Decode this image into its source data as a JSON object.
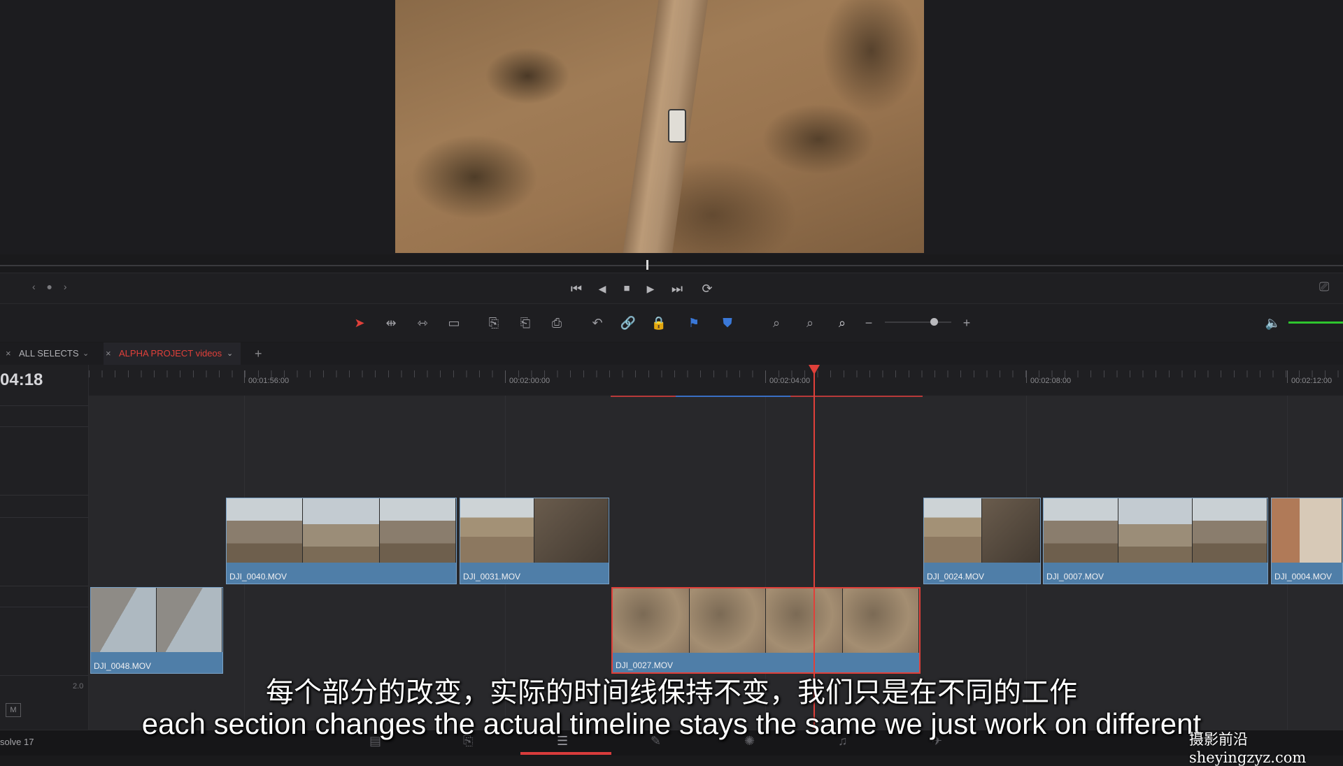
{
  "viewer": {
    "nav_dots": "‹ ● ›"
  },
  "transport": {
    "buttons": [
      {
        "name": "go-to-start",
        "glyph": "⏮"
      },
      {
        "name": "step-back",
        "glyph": "◀"
      },
      {
        "name": "stop",
        "glyph": "■"
      },
      {
        "name": "play",
        "glyph": "▶"
      },
      {
        "name": "go-to-end",
        "glyph": "⏭"
      },
      {
        "name": "loop",
        "glyph": "⟳"
      }
    ]
  },
  "toolbar": {
    "tools": [
      "➤",
      "⇹",
      "⇿",
      "▭",
      "⎘",
      "⎗",
      "⎙",
      "↶",
      "🔗",
      "🔒",
      "⚑",
      "⛊",
      "⌕",
      "⌕",
      "⌕"
    ],
    "zoom_minus": "−",
    "zoom_plus": "+",
    "volume_glyph": "🔈"
  },
  "tabs": [
    {
      "label": "ALL SELECTS",
      "active": false
    },
    {
      "label": "ALPHA PROJECT videos",
      "active": true
    }
  ],
  "tab_add": "+",
  "timeline": {
    "timecode": "04:18",
    "ruler_labels": [
      "00:01:56:00",
      "00:02:00:00",
      "00:02:04:00",
      "00:02:08:00",
      "00:02:12:00"
    ],
    "clips_v2": [
      "DJI_0040.MOV",
      "DJI_0031.MOV",
      "DJI_0024.MOV",
      "DJI_0007.MOV",
      "DJI_0004.MOV"
    ],
    "clips_v1": [
      "DJI_0048.MOV",
      "DJI_0027.MOV"
    ],
    "audio_level": "2.0",
    "mute_label": "M"
  },
  "app_name": "solve 17",
  "pages": [
    "▤",
    "⎘",
    "☰",
    "✎",
    "✺",
    "♫",
    "✈"
  ],
  "subtitles": {
    "zh": "每个部分的改变，实际的时间线保持不变，我们只是在不同的工作",
    "en": "each section changes the actual timeline stays the same we just work on different"
  },
  "watermark": "摄影前沿 sheyingzyz.com",
  "colors": {
    "playhead": "#e0403a",
    "clip": "#4f7ea8",
    "accent_green": "#2ec52e"
  }
}
